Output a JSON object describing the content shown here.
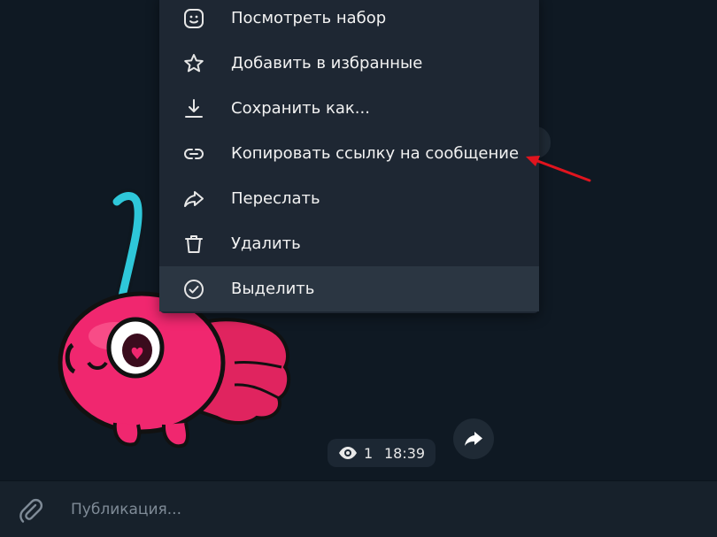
{
  "context_menu": {
    "items": [
      {
        "label": "Посмотреть набор",
        "icon": "sticker-pack-icon"
      },
      {
        "label": "Добавить в избранные",
        "icon": "star-icon"
      },
      {
        "label": "Сохранить как...",
        "icon": "download-icon"
      },
      {
        "label": "Копировать ссылку на сообщение",
        "icon": "link-icon"
      },
      {
        "label": "Переслать",
        "icon": "forward-icon"
      },
      {
        "label": "Удалить",
        "icon": "trash-icon"
      },
      {
        "label": "Выделить",
        "icon": "check-circle-icon"
      }
    ]
  },
  "message": {
    "views": "1",
    "time": "18:39"
  },
  "composer": {
    "placeholder": "Публикация..."
  },
  "colors": {
    "chat_bg": "#0f1923",
    "menu_bg": "#1e2733",
    "menu_active": "#2b3642",
    "annotation_arrow": "#e0141e",
    "sticker_pink": "#f0276f",
    "sticker_stem": "#2ec7d9"
  }
}
